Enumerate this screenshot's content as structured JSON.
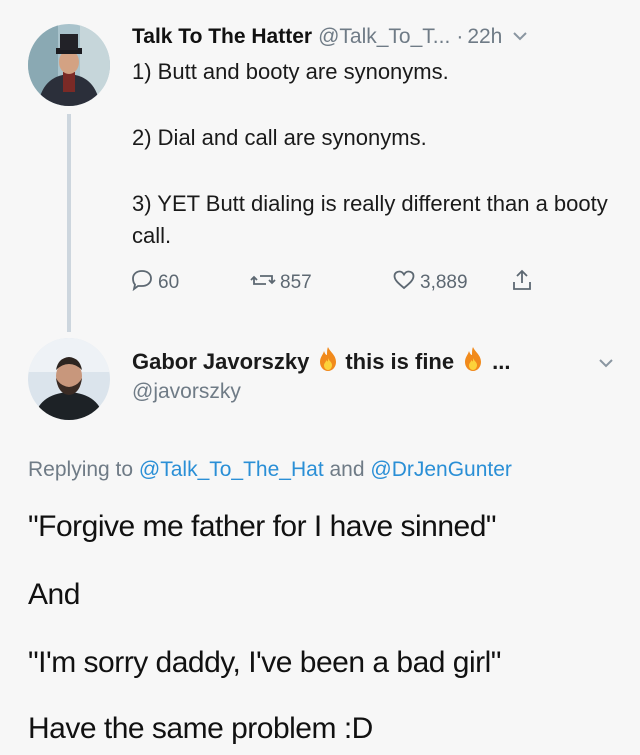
{
  "tweet": {
    "author_name": "Talk To The Hatter",
    "author_handle": "@Talk_To_T...",
    "separator": "·",
    "time": "22h",
    "lines": [
      "1) Butt and booty are synonyms.",
      "2) Dial and call are synonyms.",
      "3) YET Butt dialing is really different than a booty call."
    ],
    "reply_count": "60",
    "retweet_count": "857",
    "like_count": "3,889"
  },
  "reply": {
    "author_name": "Gabor Javorszky",
    "name_suffix": "this is fine",
    "ellipsis": "...",
    "author_handle": "@javorszky",
    "replying_prefix": "Replying to",
    "mention_1": "@Talk_To_The_Hat",
    "conjunction": "and",
    "mention_2": "@DrJenGunter",
    "text_lines": [
      "\"Forgive me father for I have sinned\"",
      "And",
      "\"I'm sorry daddy, I've been a bad girl\"",
      "Have the same problem :D"
    ]
  },
  "colors": {
    "background": "#f7f7f7",
    "secondary_text": "#6f7b86",
    "link": "#2a8fd6",
    "thread_line": "#cdd6de"
  },
  "icons": [
    "reply-icon",
    "retweet-icon",
    "like-icon",
    "share-icon",
    "chevron-down-icon",
    "fire-icon"
  ]
}
